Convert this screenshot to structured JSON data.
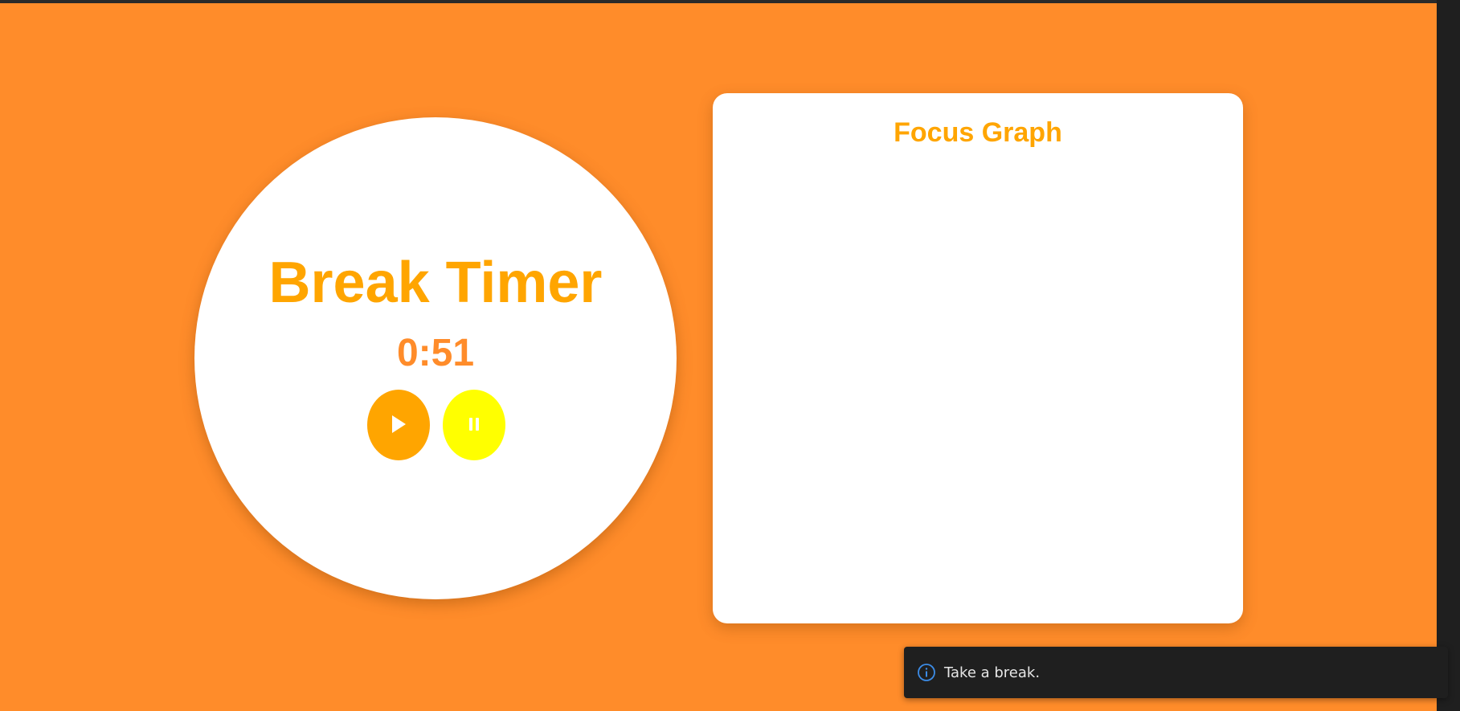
{
  "timer": {
    "title": "Break Timer",
    "time": "0:51",
    "play_icon": "play-icon",
    "pause_icon": "pause-icon"
  },
  "graph": {
    "title": "Focus Graph"
  },
  "toast": {
    "icon": "info-icon",
    "message": "Take a break."
  },
  "colors": {
    "background": "#ff8c2a",
    "accent": "#ffa500",
    "pause_button": "#ffff00",
    "time_text": "#ff8c2a",
    "toast_background": "#1f1f1f",
    "info_icon": "#3c8ce7"
  }
}
